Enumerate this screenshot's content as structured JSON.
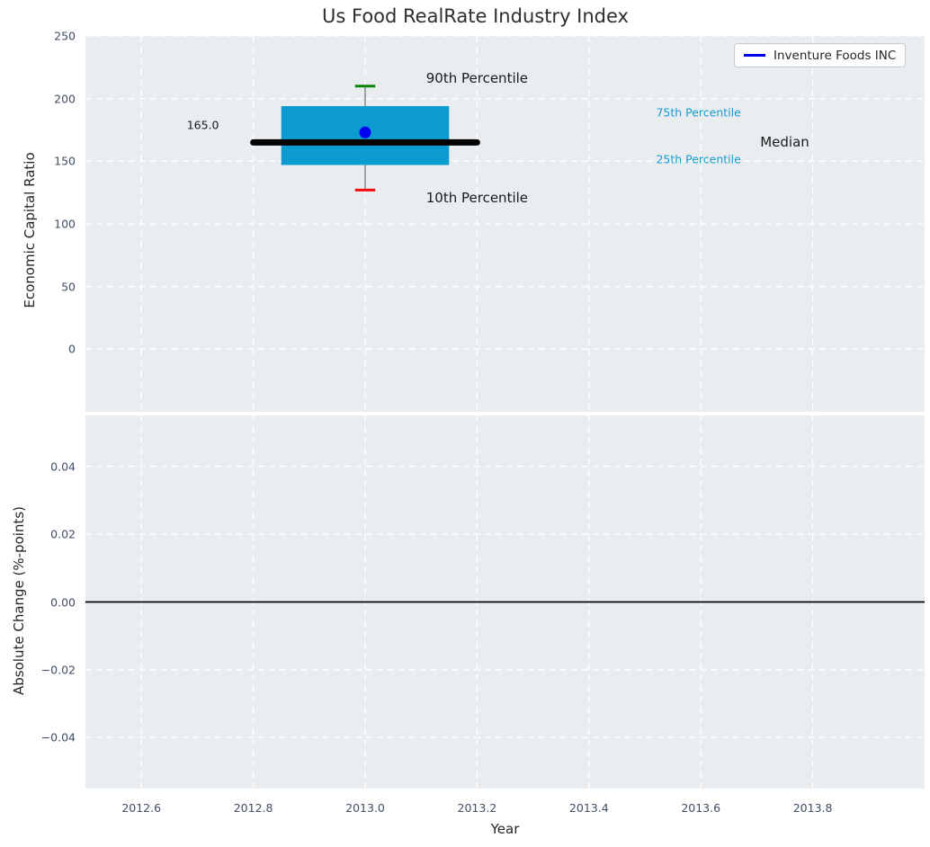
{
  "title": "Us Food RealRate Industry Index",
  "colors": {
    "axes_background": "#e9edf0",
    "grid": "#ffffff",
    "tick_label": "#3f4e63",
    "box_fill": "#0d9cd1",
    "percentile_text": "#1a9bd0",
    "company_blue": "#0000f0",
    "p90_cap_green": "#0a850a",
    "p10_cap_red": "#f20d0d",
    "median_black": "#000000",
    "whisker_gray": "#888888"
  },
  "xaxis": {
    "label": "Year",
    "xlim": [
      2012.5,
      2014.0
    ],
    "ticks": [
      2012.6,
      2012.8,
      2013.0,
      2013.2,
      2013.4,
      2013.6,
      2013.8
    ],
    "tick_labels": [
      "2012.6",
      "2012.8",
      "2013.0",
      "2013.2",
      "2013.4",
      "2013.6",
      "2013.8"
    ]
  },
  "chart_data": [
    {
      "type": "box",
      "title": "Us Food RealRate Industry Index",
      "ylabel": "Economic Capital Ratio",
      "ylim": [
        -50,
        250
      ],
      "yticks": [
        0,
        50,
        100,
        150,
        200,
        250
      ],
      "ytick_labels": [
        "0",
        "50",
        "100",
        "150",
        "200",
        "250"
      ],
      "grid": true,
      "x": 2013.0,
      "box": {
        "p10": 127,
        "p25": 147,
        "median": 165,
        "p75": 194,
        "p90": 210,
        "box_halfwidth_years": 0.15,
        "median_halfwidth_years": 0.2,
        "cap_halfwidth_years": 0.018
      },
      "company_point": {
        "name": "Inventure Foods INC",
        "year": 2013.0,
        "value": 173
      },
      "legend": {
        "label": "Inventure Foods INC",
        "position": "upper right"
      },
      "annotations": [
        {
          "name": "p90-label",
          "text": "90th Percentile",
          "x": 2013.2,
          "y": 216,
          "color": "#1a1a1a",
          "size": 15,
          "anchor": "middle"
        },
        {
          "name": "p10-label",
          "text": "10th Percentile",
          "x": 2013.2,
          "y": 121,
          "color": "#1a1a1a",
          "size": 15,
          "anchor": "middle"
        },
        {
          "name": "p75-label",
          "text": "75th Percentile",
          "x": 2013.52,
          "y": 189,
          "color": "#1a9bd0",
          "size": 12.5,
          "anchor": "start"
        },
        {
          "name": "p25-label",
          "text": "25th Percentile",
          "x": 2013.52,
          "y": 152,
          "color": "#1a9bd0",
          "size": 12.5,
          "anchor": "start"
        },
        {
          "name": "median-label",
          "text": "Median",
          "x": 2013.75,
          "y": 165,
          "color": "#1a1a1a",
          "size": 15,
          "anchor": "middle"
        },
        {
          "name": "median-value",
          "text": "165.0",
          "x": 2012.71,
          "y": 179,
          "color": "#1a1a1a",
          "size": 12.5,
          "anchor": "middle"
        }
      ]
    },
    {
      "type": "line",
      "ylabel": "Absolute Change (%-points)",
      "ylim": [
        -0.055,
        0.055
      ],
      "yticks": [
        -0.04,
        -0.02,
        0.0,
        0.02,
        0.04
      ],
      "ytick_labels": [
        "−0.04",
        "−0.02",
        "0.00",
        "0.02",
        "0.04"
      ],
      "grid": true,
      "series": [],
      "zero_line": 0.0
    }
  ]
}
